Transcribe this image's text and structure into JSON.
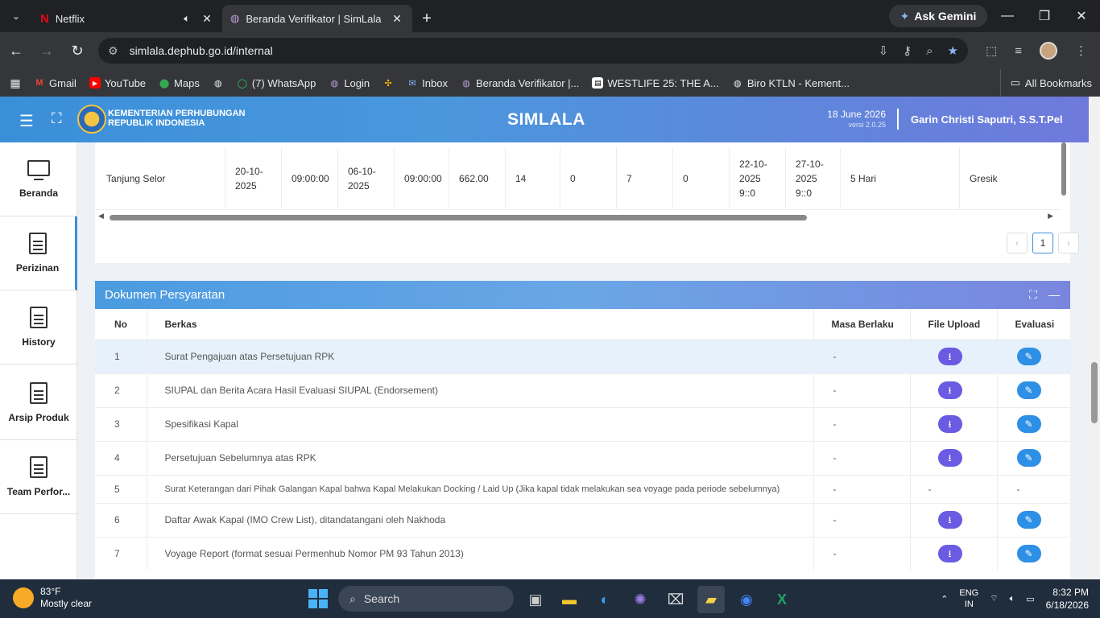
{
  "browser": {
    "tabs": [
      {
        "label": "Netflix",
        "audio": true
      },
      {
        "label": "Beranda Verifikator | SimLala",
        "active": true
      }
    ],
    "gemini_label": "Ask Gemini",
    "url": "simlala.dephub.go.id/internal",
    "bookmarks": [
      {
        "label": "Gmail",
        "icon": "gmail-icon"
      },
      {
        "label": "YouTube",
        "icon": "youtube-icon"
      },
      {
        "label": "Maps",
        "icon": "maps-icon"
      },
      {
        "label": "",
        "icon": "globe-icon"
      },
      {
        "label": "(7) WhatsApp",
        "icon": "whatsapp-icon"
      },
      {
        "label": "Login",
        "icon": "globe-icon"
      },
      {
        "label": "",
        "icon": "pinwheel-icon"
      },
      {
        "label": "Inbox",
        "icon": "inbox-icon"
      },
      {
        "label": "Beranda Verifikator |...",
        "icon": "globe-icon"
      },
      {
        "label": "WESTLIFE 25: THE A...",
        "icon": "bookmark-icon"
      },
      {
        "label": "Biro KTLN - Kement...",
        "icon": "globe-icon"
      }
    ],
    "all_bookmarks": "All Bookmarks"
  },
  "header": {
    "ministry_line1": "KEMENTERIAN PERHUBUNGAN",
    "ministry_line2": "REPUBLIK INDONESIA",
    "app_title": "SIMLALA",
    "date": "18 June 2026",
    "version": "versi 2.0.25",
    "user": "Garin Christi Saputri, S.S.T.Pel"
  },
  "sidebar": {
    "items": [
      {
        "label": "Beranda",
        "icon": "monitor-icon"
      },
      {
        "label": "Perizinan",
        "icon": "document-icon",
        "active": true
      },
      {
        "label": "History",
        "icon": "document-icon"
      },
      {
        "label": "Arsip Produk",
        "icon": "document-icon"
      },
      {
        "label": "Team Perfor...",
        "icon": "document-icon"
      }
    ]
  },
  "schedule_row": {
    "cells": [
      "Tanjung Selor",
      "20-10-\n2025",
      "09:00:00",
      "06-10-\n2025",
      "09:00:00",
      "662.00",
      "14",
      "0",
      "7",
      "0",
      "22-10-\n2025\n9::0",
      "27-10-\n2025\n9::0",
      "5 Hari",
      "Gresik"
    ],
    "page": "1"
  },
  "dokumen": {
    "title": "Dokumen Persyaratan",
    "columns": {
      "no": "No",
      "berkas": "Berkas",
      "masa": "Masa Berlaku",
      "file": "File Upload",
      "eval": "Evaluasi"
    },
    "rows": [
      {
        "no": "1",
        "berkas": "Surat Pengajuan atas Persetujuan RPK",
        "masa": "-",
        "has_actions": true
      },
      {
        "no": "2",
        "berkas": "SIUPAL dan Berita Acara Hasil Evaluasi SIUPAL (Endorsement)",
        "masa": "-",
        "has_actions": true
      },
      {
        "no": "3",
        "berkas": "Spesifikasi Kapal",
        "masa": "-",
        "has_actions": true
      },
      {
        "no": "4",
        "berkas": "Persetujuan Sebelumnya atas RPK",
        "masa": "-",
        "has_actions": true
      },
      {
        "no": "5",
        "berkas": "Surat Keterangan dari Pihak Galangan Kapal bahwa Kapal Melakukan Docking / Laid Up (Jika kapal tidak melakukan sea voyage pada periode sebelumnya)",
        "masa": "-",
        "has_actions": false,
        "file": "-",
        "eval": "-"
      },
      {
        "no": "6",
        "berkas": "Daftar Awak Kapal (IMO Crew List), ditandatangani oleh Nakhoda",
        "masa": "-",
        "has_actions": true
      },
      {
        "no": "7",
        "berkas": "Voyage Report (format sesuai Permenhub Nomor PM 93 Tahun 2013)",
        "masa": "-",
        "has_actions": true
      }
    ]
  },
  "taskbar": {
    "temp": "83°F",
    "weather": "Mostly clear",
    "search": "Search",
    "lang1": "ENG",
    "lang2": "IN",
    "time": "8:32 PM",
    "date": "6/18/2026"
  }
}
